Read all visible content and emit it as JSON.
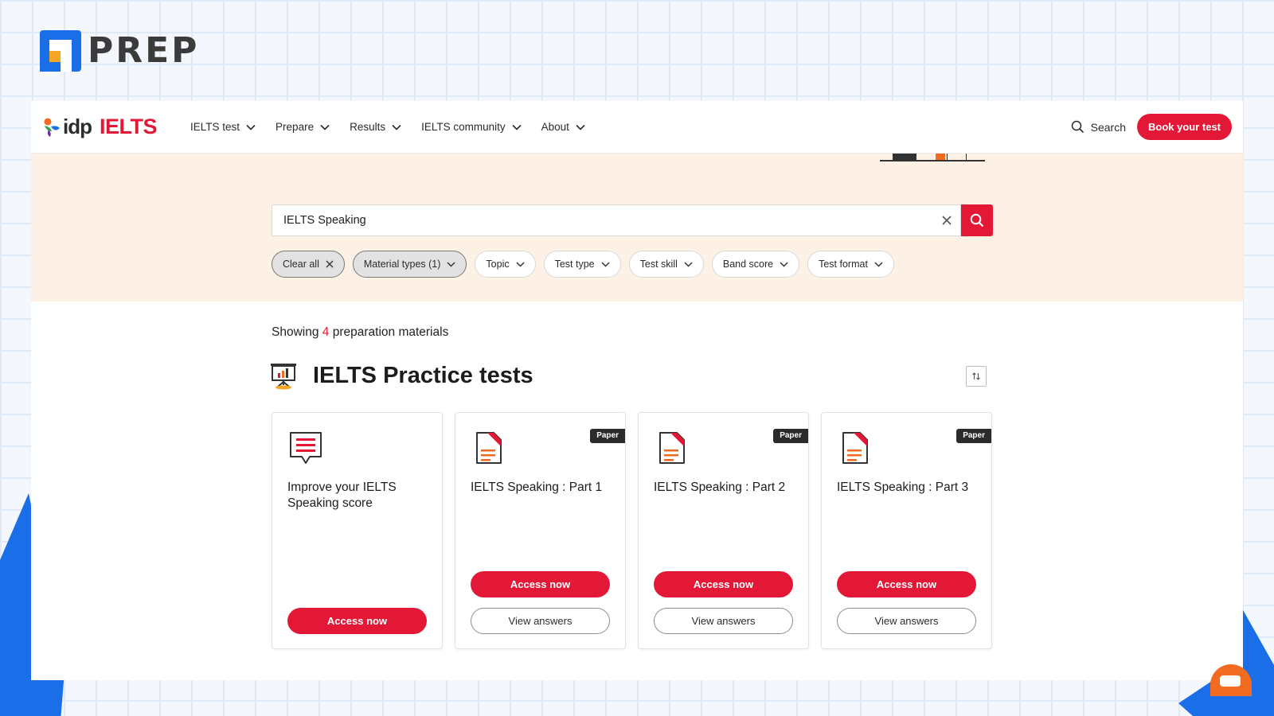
{
  "brand": {
    "name": "PREP"
  },
  "nav": {
    "logo_idp": "idp",
    "logo_ielts": "IELTS",
    "items": [
      {
        "label": "IELTS test"
      },
      {
        "label": "Prepare"
      },
      {
        "label": "Results"
      },
      {
        "label": "IELTS community"
      },
      {
        "label": "About"
      }
    ],
    "search_label": "Search",
    "book_label": "Book your test"
  },
  "search": {
    "value": "IELTS Speaking"
  },
  "filters": {
    "clear_all": "Clear all",
    "material_types": "Material types (1)",
    "topic": "Topic",
    "test_type": "Test type",
    "test_skill": "Test skill",
    "band_score": "Band score",
    "test_format": "Test format"
  },
  "results": {
    "prefix": "Showing",
    "count": "4",
    "suffix": "preparation materials"
  },
  "section": {
    "title": "IELTS Practice tests"
  },
  "cards": [
    {
      "title": "Improve your IELTS Speaking score",
      "badge": "",
      "primary": "Access now",
      "secondary": ""
    },
    {
      "title": "IELTS Speaking : Part 1",
      "badge": "Paper",
      "primary": "Access now",
      "secondary": "View answers"
    },
    {
      "title": "IELTS Speaking : Part 2",
      "badge": "Paper",
      "primary": "Access now",
      "secondary": "View answers"
    },
    {
      "title": "IELTS Speaking : Part 3",
      "badge": "Paper",
      "primary": "Access now",
      "secondary": "View answers"
    }
  ],
  "colors": {
    "accent_red": "#e31837",
    "prep_blue": "#1a6ee8",
    "prep_orange": "#f5a623",
    "hero_bg": "#fdf1e5"
  }
}
